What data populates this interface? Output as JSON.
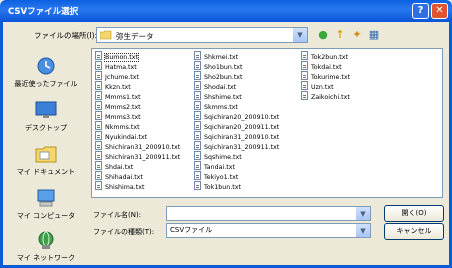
{
  "window": {
    "title": "CSVファイル選択",
    "help_label": "?",
    "close_label": "✕"
  },
  "lookin": {
    "label": "ファイルの場所(I):",
    "value": "弥生データ"
  },
  "toolbar": {
    "back_glyph": "●",
    "up_glyph": "↑",
    "newfolder_glyph": "✦",
    "view_glyph": "▦"
  },
  "places": [
    {
      "label": "最近使ったファイル",
      "icon": "recent-documents-icon"
    },
    {
      "label": "デスクトップ",
      "icon": "desktop-icon"
    },
    {
      "label": "マイ ドキュメント",
      "icon": "my-documents-icon"
    },
    {
      "label": "マイ コンピュータ",
      "icon": "my-computer-icon"
    },
    {
      "label": "マイ ネットワーク",
      "icon": "my-network-icon"
    }
  ],
  "files": {
    "col1": [
      "Bumon.txt",
      "Hatma.txt",
      "Jchume.txt",
      "Kkzn.txt",
      "Mmms1.txt",
      "Mmms2.txt",
      "Mmms3.txt",
      "Nkmms.txt",
      "Nyukindai.txt",
      "Shichiran31_200910.txt",
      "Shichiran31_200911.txt",
      "Shdai.txt",
      "Shihadai.txt",
      "Shishima.txt"
    ],
    "col2": [
      "Shkmei.txt",
      "Sho1bun.txt",
      "Sho2bun.txt",
      "Shodai.txt",
      "Shshime.txt",
      "Skmms.txt",
      "Sqichiran20_200910.txt",
      "Sqichiran20_200911.txt",
      "Sqichiran31_200910.txt",
      "Sqichiran31_200911.txt",
      "Sqshime.txt",
      "Tandai.txt",
      "Tekiyo1.txt",
      "Tok1bun.txt"
    ],
    "col3": [
      "Tok2bun.txt",
      "Tokdai.txt",
      "Tokurime.txt",
      "Uzn.txt",
      "Zaikoichi.txt"
    ]
  },
  "filename": {
    "label": "ファイル名(N):",
    "value": ""
  },
  "filetype": {
    "label": "ファイルの種類(T):",
    "value": "CSVファイル"
  },
  "buttons": {
    "open": "開く(O)",
    "cancel": "キャンセル"
  },
  "colors": {
    "titlebar": "#0a5fe0",
    "dialog_bg": "#ece9d8",
    "list_bg": "#ffffff"
  }
}
